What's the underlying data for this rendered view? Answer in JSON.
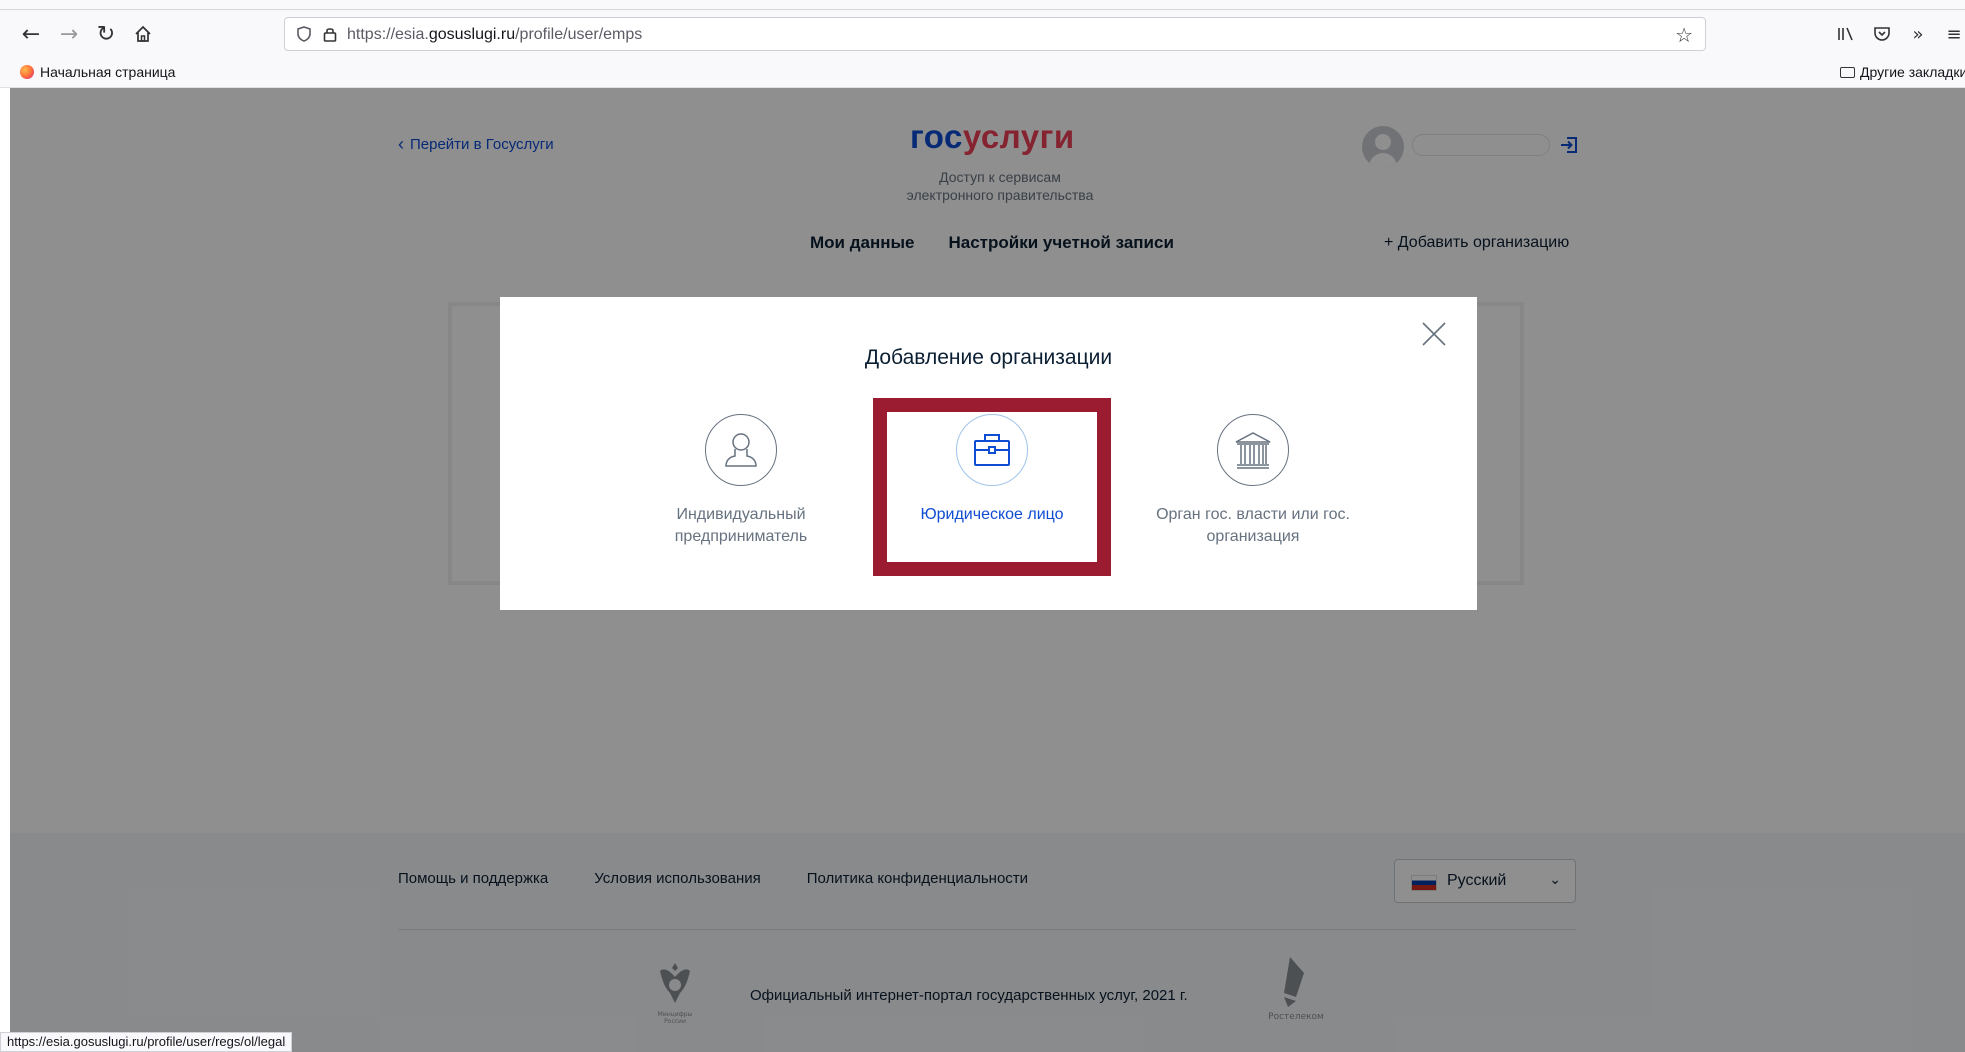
{
  "browser": {
    "url_prefix": "https://esia.",
    "url_domain": "gosuslugi.ru",
    "url_path": "/profile/user/emps",
    "bookmark_home": "Начальная страница",
    "bookmark_other": "Другие закладки",
    "status_url": "https://esia.gosuslugi.ru/profile/user/regs/ol/legal"
  },
  "header": {
    "back_link": "Перейти в Госуслуги",
    "logo_part1": "гос",
    "logo_part2": "услуги",
    "subtitle_line1": "Доступ к сервисам",
    "subtitle_line2": "электронного правительства",
    "tabs": [
      "Мои данные",
      "Настройки учетной записи"
    ],
    "add_org": "+ Добавить организацию"
  },
  "modal": {
    "title": "Добавление организации",
    "options": [
      {
        "line1": "Индивидуальный",
        "line2": "предприниматель",
        "icon": "person-icon"
      },
      {
        "line1": "Юридическое лицо",
        "line2": "",
        "icon": "briefcase-icon",
        "selected": true
      },
      {
        "line1": "Орган гос. власти или гос.",
        "line2": "организация",
        "icon": "government-building-icon"
      }
    ]
  },
  "footer": {
    "links": [
      "Помощь и поддержка",
      "Условия использования",
      "Политика конфиденциальности"
    ],
    "language": "Русский",
    "official_text": "Официальный интернет-портал государственных услуг, 2021 г.",
    "emblem_caption_1": "Минцифры",
    "emblem_caption_2": "России",
    "rt_caption": "Ростелеком"
  },
  "colors": {
    "brand_blue": "#0d4cd3",
    "brand_red": "#ee3f58",
    "highlight": "#9b1b30"
  }
}
